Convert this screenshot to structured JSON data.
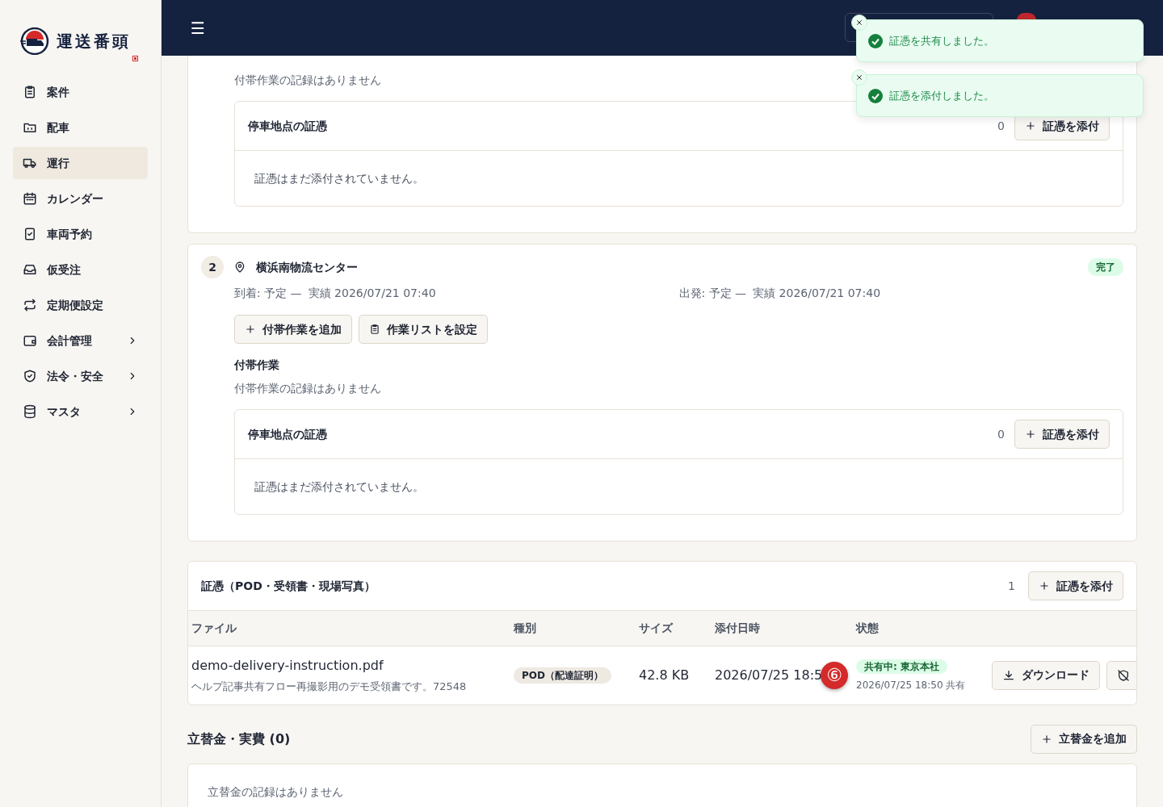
{
  "sidebar": {
    "logo_text": "運送番頭",
    "items": [
      {
        "label": "案件",
        "selected": false,
        "expandable": false
      },
      {
        "label": "配車",
        "selected": false,
        "expandable": false
      },
      {
        "label": "運行",
        "selected": true,
        "expandable": false
      },
      {
        "label": "カレンダー",
        "selected": false,
        "expandable": false
      },
      {
        "label": "車両予約",
        "selected": false,
        "expandable": false
      },
      {
        "label": "仮受注",
        "selected": false,
        "expandable": false
      },
      {
        "label": "定期便設定",
        "selected": false,
        "expandable": false
      },
      {
        "label": "会計管理",
        "selected": false,
        "expandable": true
      },
      {
        "label": "法令・安全",
        "selected": false,
        "expandable": true
      },
      {
        "label": "マスタ",
        "selected": false,
        "expandable": true
      }
    ]
  },
  "header": {
    "menu_glyph": "☰"
  },
  "toasts": [
    {
      "message": "証憑を共有しました。"
    },
    {
      "message": "証憑を添付しました。"
    }
  ],
  "stops": [
    {
      "partial": true,
      "extra_work_empty": "付帯作業の記録はありません",
      "evidence": {
        "title": "停車地点の証憑",
        "count": "0",
        "button": "証憑を添付",
        "empty": "証憑はまだ添付されていません。"
      }
    },
    {
      "partial": false,
      "number": "2",
      "name": "横浜南物流センター",
      "status": "完了",
      "arrival": {
        "label": "到着: 予定 —",
        "actual": "実績 2026/07/21 07:40"
      },
      "departure": {
        "label": "出発: 予定 —",
        "actual": "実績 2026/07/21 07:40"
      },
      "buttons": [
        "付帯作業を追加",
        "作業リストを設定"
      ],
      "extra_work_title": "付帯作業",
      "extra_work_empty": "付帯作業の記録はありません",
      "evidence": {
        "title": "停車地点の証憑",
        "count": "0",
        "button": "証憑を添付",
        "empty": "証憑はまだ添付されていません。"
      }
    }
  ],
  "evidence": {
    "title": "証憑（POD・受領書・現場写真）",
    "count": "1",
    "button": "証憑を添付",
    "columns": [
      "ファイル",
      "種別",
      "サイズ",
      "添付日時",
      "状態"
    ],
    "rows": [
      {
        "file": "demo-delivery-instruction.pdf",
        "description": "ヘルプ記事共有フロー再撮影用のデモ受領書です。72548",
        "type": "POD（配達証明）",
        "size": "42.8 KB",
        "attached": "2026/07/25 18:5",
        "callout": "⑥",
        "status": "共有中: 東京本社",
        "status_note": "2026/07/25 18:50 共有",
        "download": "ダウンロード"
      }
    ]
  },
  "advances": {
    "title": "立替金・実費 (0)",
    "button": "立替金を追加",
    "empty": "立替金の記録はありません"
  }
}
